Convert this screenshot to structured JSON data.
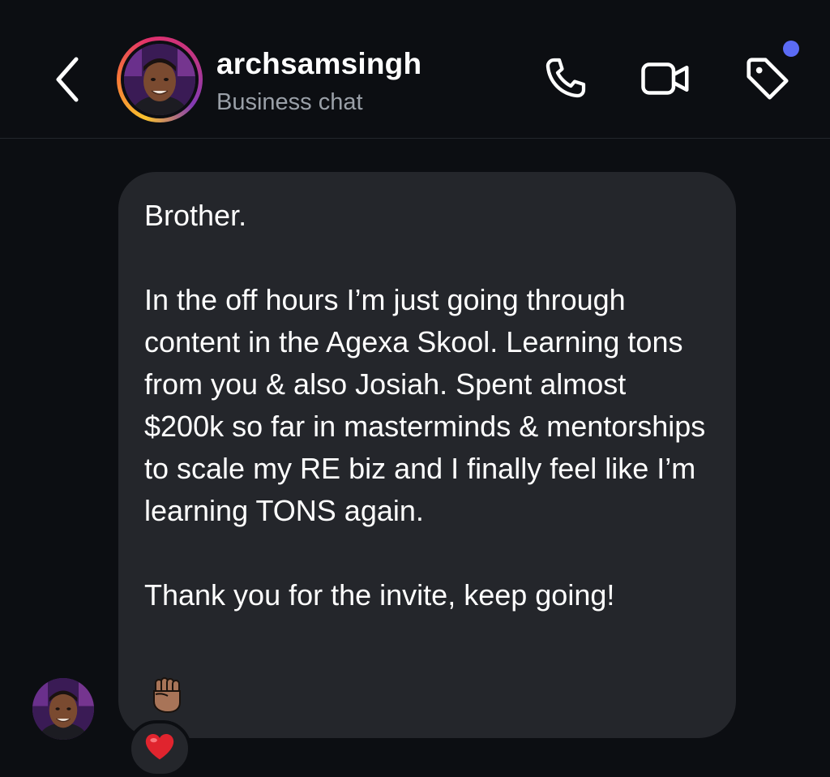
{
  "header": {
    "username": "archsamsingh",
    "subtitle": "Business chat",
    "icons": {
      "back": "chevron-left-icon",
      "call": "phone-icon",
      "video": "video-camera-icon",
      "label": "tag-icon"
    },
    "avatar_ring_colors": [
      "#f9c22e",
      "#f77737",
      "#e1306c",
      "#c13584",
      "#833ab4"
    ],
    "notification_dot_color": "#5b6bf5"
  },
  "message": {
    "paragraphs": [
      "Brother.",
      "In the off hours I’m just going through content in the Agexa Skool. Learning tons from you & also Josiah. Spent almost $200k so far in masterminds & mentorships to scale my RE biz and I finally feel like I’m learning TONS again.",
      "Thank you for the invite, keep going!"
    ],
    "trailing_emoji": "raised-fist-medium-skin-tone-icon",
    "reaction": "red-heart-icon",
    "bubble_color": "#24262b"
  },
  "theme": {
    "background": "#0c0e12",
    "text": "#ffffff",
    "secondary_text": "#9aa0a8"
  }
}
